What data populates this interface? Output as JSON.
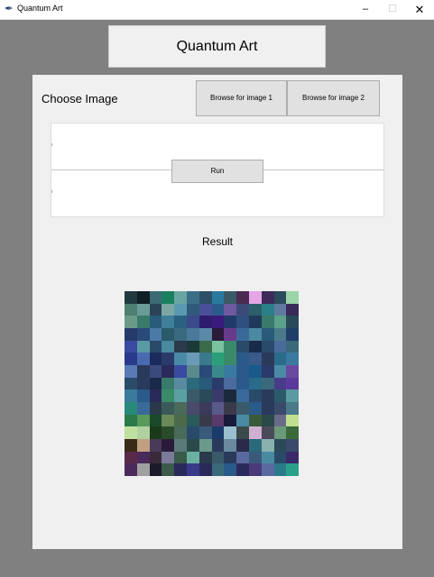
{
  "window": {
    "title": "Quantum Art",
    "app_icon": "feather-icon",
    "controls": {
      "minimize": "–",
      "maximize": "☐",
      "close": "✕"
    }
  },
  "header": {
    "title": "Quantum Art"
  },
  "panel": {
    "choose_label": "Choose Image",
    "browse1_label": "Browse for image 1",
    "browse2_label": "Browse for image 2",
    "run_label": "Run",
    "result_label": "Result"
  },
  "result_image": {
    "columns": 15,
    "rows": 15,
    "colors": [
      "#203a3f",
      "#0f1f24",
      "#3c6a74",
      "#19805f",
      "#6aa6a1",
      "#3b6f87",
      "#2d5066",
      "#2a7aa0",
      "#3a5a66",
      "#4b2a52",
      "#e6a6e6",
      "#3d2a5a",
      "#2b4a5c",
      "#9ad4a9",
      "#f0f0f0",
      "#4e7f70",
      "#6a9b98",
      "#2b4356",
      "#7aa7a2",
      "#5a9ab0",
      "#2f5a7a",
      "#4a4f9a",
      "#2a5b8c",
      "#6f5aa0",
      "#3c4a7a",
      "#2b5f6a",
      "#2a7f88",
      "#5f7a9f",
      "#3a2a5a",
      "#f0f0f0",
      "#6a9b89",
      "#3a7a6a",
      "#2a5b7a",
      "#3f7f9a",
      "#2a6080",
      "#3a4a8a",
      "#2e1c6c",
      "#3a1a7a",
      "#223a6a",
      "#2f4f7f",
      "#1f3a5a",
      "#3a7a6a",
      "#5aa08a",
      "#2a4a5a",
      "#f0f0f0",
      "#263b6b",
      "#2a4a7a",
      "#4a7aa5",
      "#2a5a6a",
      "#3a6a7f",
      "#4a7a9a",
      "#5a8aa5",
      "#2b1a3a",
      "#6a3a8a",
      "#3a6a9a",
      "#4a8aa0",
      "#2a5a7a",
      "#4a7a8a",
      "#1f3f6a",
      "#f0f0f0",
      "#3a4aa0",
      "#5a9aa5",
      "#2a4a6a",
      "#4a8aa0",
      "#2a3a4a",
      "#1a3a3a",
      "#3a6a4a",
      "#7ac2a0",
      "#3a8a6a",
      "#2a4a6a",
      "#1a2a4a",
      "#2a4a6a",
      "#4a6a9a",
      "#3a6a7a",
      "#f0f0f0",
      "#2a3a8a",
      "#4a6ab0",
      "#1a2a5a",
      "#2a3a6a",
      "#4a8aa5",
      "#6a9ab5",
      "#3a7a8a",
      "#2aa07a",
      "#3a8a6a",
      "#2a5a8a",
      "#3a5a8a",
      "#2a3a5a",
      "#2a6a8a",
      "#3a7aa0",
      "#f0f0f0",
      "#5a7ab5",
      "#2a3a5a",
      "#3a4a7a",
      "#2a2a5a",
      "#3a4aa0",
      "#5a8a8a",
      "#2a4a7a",
      "#3a8a8a",
      "#3a7aa0",
      "#2a5a8a",
      "#1a5a8a",
      "#2a3a6a",
      "#4a8aa5",
      "#6a4aa0",
      "#f0f0f0",
      "#2a4a6a",
      "#2a3a5a",
      "#1a2a4a",
      "#3a7a6a",
      "#5a8aa0",
      "#2a6a7a",
      "#2a5a7a",
      "#2a3a6a",
      "#4a6aa0",
      "#2a5a8a",
      "#2a6a8a",
      "#3a6a7a",
      "#4a3a8a",
      "#5a3a9a",
      "#f0f0f0",
      "#3a7a9a",
      "#2a5a8a",
      "#2a2a5a",
      "#3a8a6a",
      "#5aa0a0",
      "#3a5a6a",
      "#2a4a5a",
      "#3a3a6a",
      "#1a2a3a",
      "#3a6a9a",
      "#2a4a6a",
      "#2a3a5a",
      "#2a5a6a",
      "#5a9aa0",
      "#f0f0f0",
      "#2a8a7a",
      "#3a6a9a",
      "#2a3a4a",
      "#3a5a5a",
      "#4a6a5a",
      "#4a4a6a",
      "#3a3a5a",
      "#5a5a8a",
      "#3a3a4a",
      "#3a5a6a",
      "#2a5a8a",
      "#2a3a5a",
      "#3a4a6a",
      "#4a7a8a",
      "#f0f0f0",
      "#2a7a4a",
      "#5a9a5a",
      "#1a4a2a",
      "#6a8a5a",
      "#4a6a4a",
      "#2a5a5a",
      "#3a3a4a",
      "#5a3a6a",
      "#1a1a3a",
      "#4a8aa5",
      "#3a5a3a",
      "#2a4a4a",
      "#6a6a8a",
      "#c0e090",
      "#f0f0f0",
      "#c0e0a0",
      "#b0d0a0",
      "#1a3a1a",
      "#2a4a2a",
      "#4a6a5a",
      "#2a4a6a",
      "#3a5a7a",
      "#1a3a6a",
      "#9ac0d0",
      "#3a4a4a",
      "#d0b0d0",
      "#4a4a5a",
      "#6a9a7a",
      "#3a6a3a",
      "#f0f0f0",
      "#3a2a1a",
      "#c0a080",
      "#4a3a5a",
      "#2a1a3a",
      "#5a7a7a",
      "#2a4a4a",
      "#6a9a8a",
      "#2a3a5a",
      "#6a8aa0",
      "#2a2a4a",
      "#2a6a7a",
      "#8ab0b0",
      "#2a4a5a",
      "#3a4a6a",
      "#f0f0f0",
      "#5a2a4a",
      "#4a2a5a",
      "#3a2a3a",
      "#7a7a9a",
      "#3a5a4a",
      "#6ab0a0",
      "#2a3a4a",
      "#3a5a6a",
      "#2a3a5a",
      "#5a6aa0",
      "#3a5a7a",
      "#4a8aa0",
      "#2a4a6a",
      "#3a2a6a",
      "#f0f0f0",
      "#4a2a5a",
      "#a0a0a0",
      "#1a1a2a",
      "#3a5a4a",
      "#2a2a5a",
      "#3a3a8a",
      "#2a2a5a",
      "#3a6a7a",
      "#2a5a8a",
      "#2a2a5a",
      "#4a3a7a",
      "#5a6aa0",
      "#2a7a8a",
      "#2aa08a",
      "#f0f0f0"
    ]
  }
}
